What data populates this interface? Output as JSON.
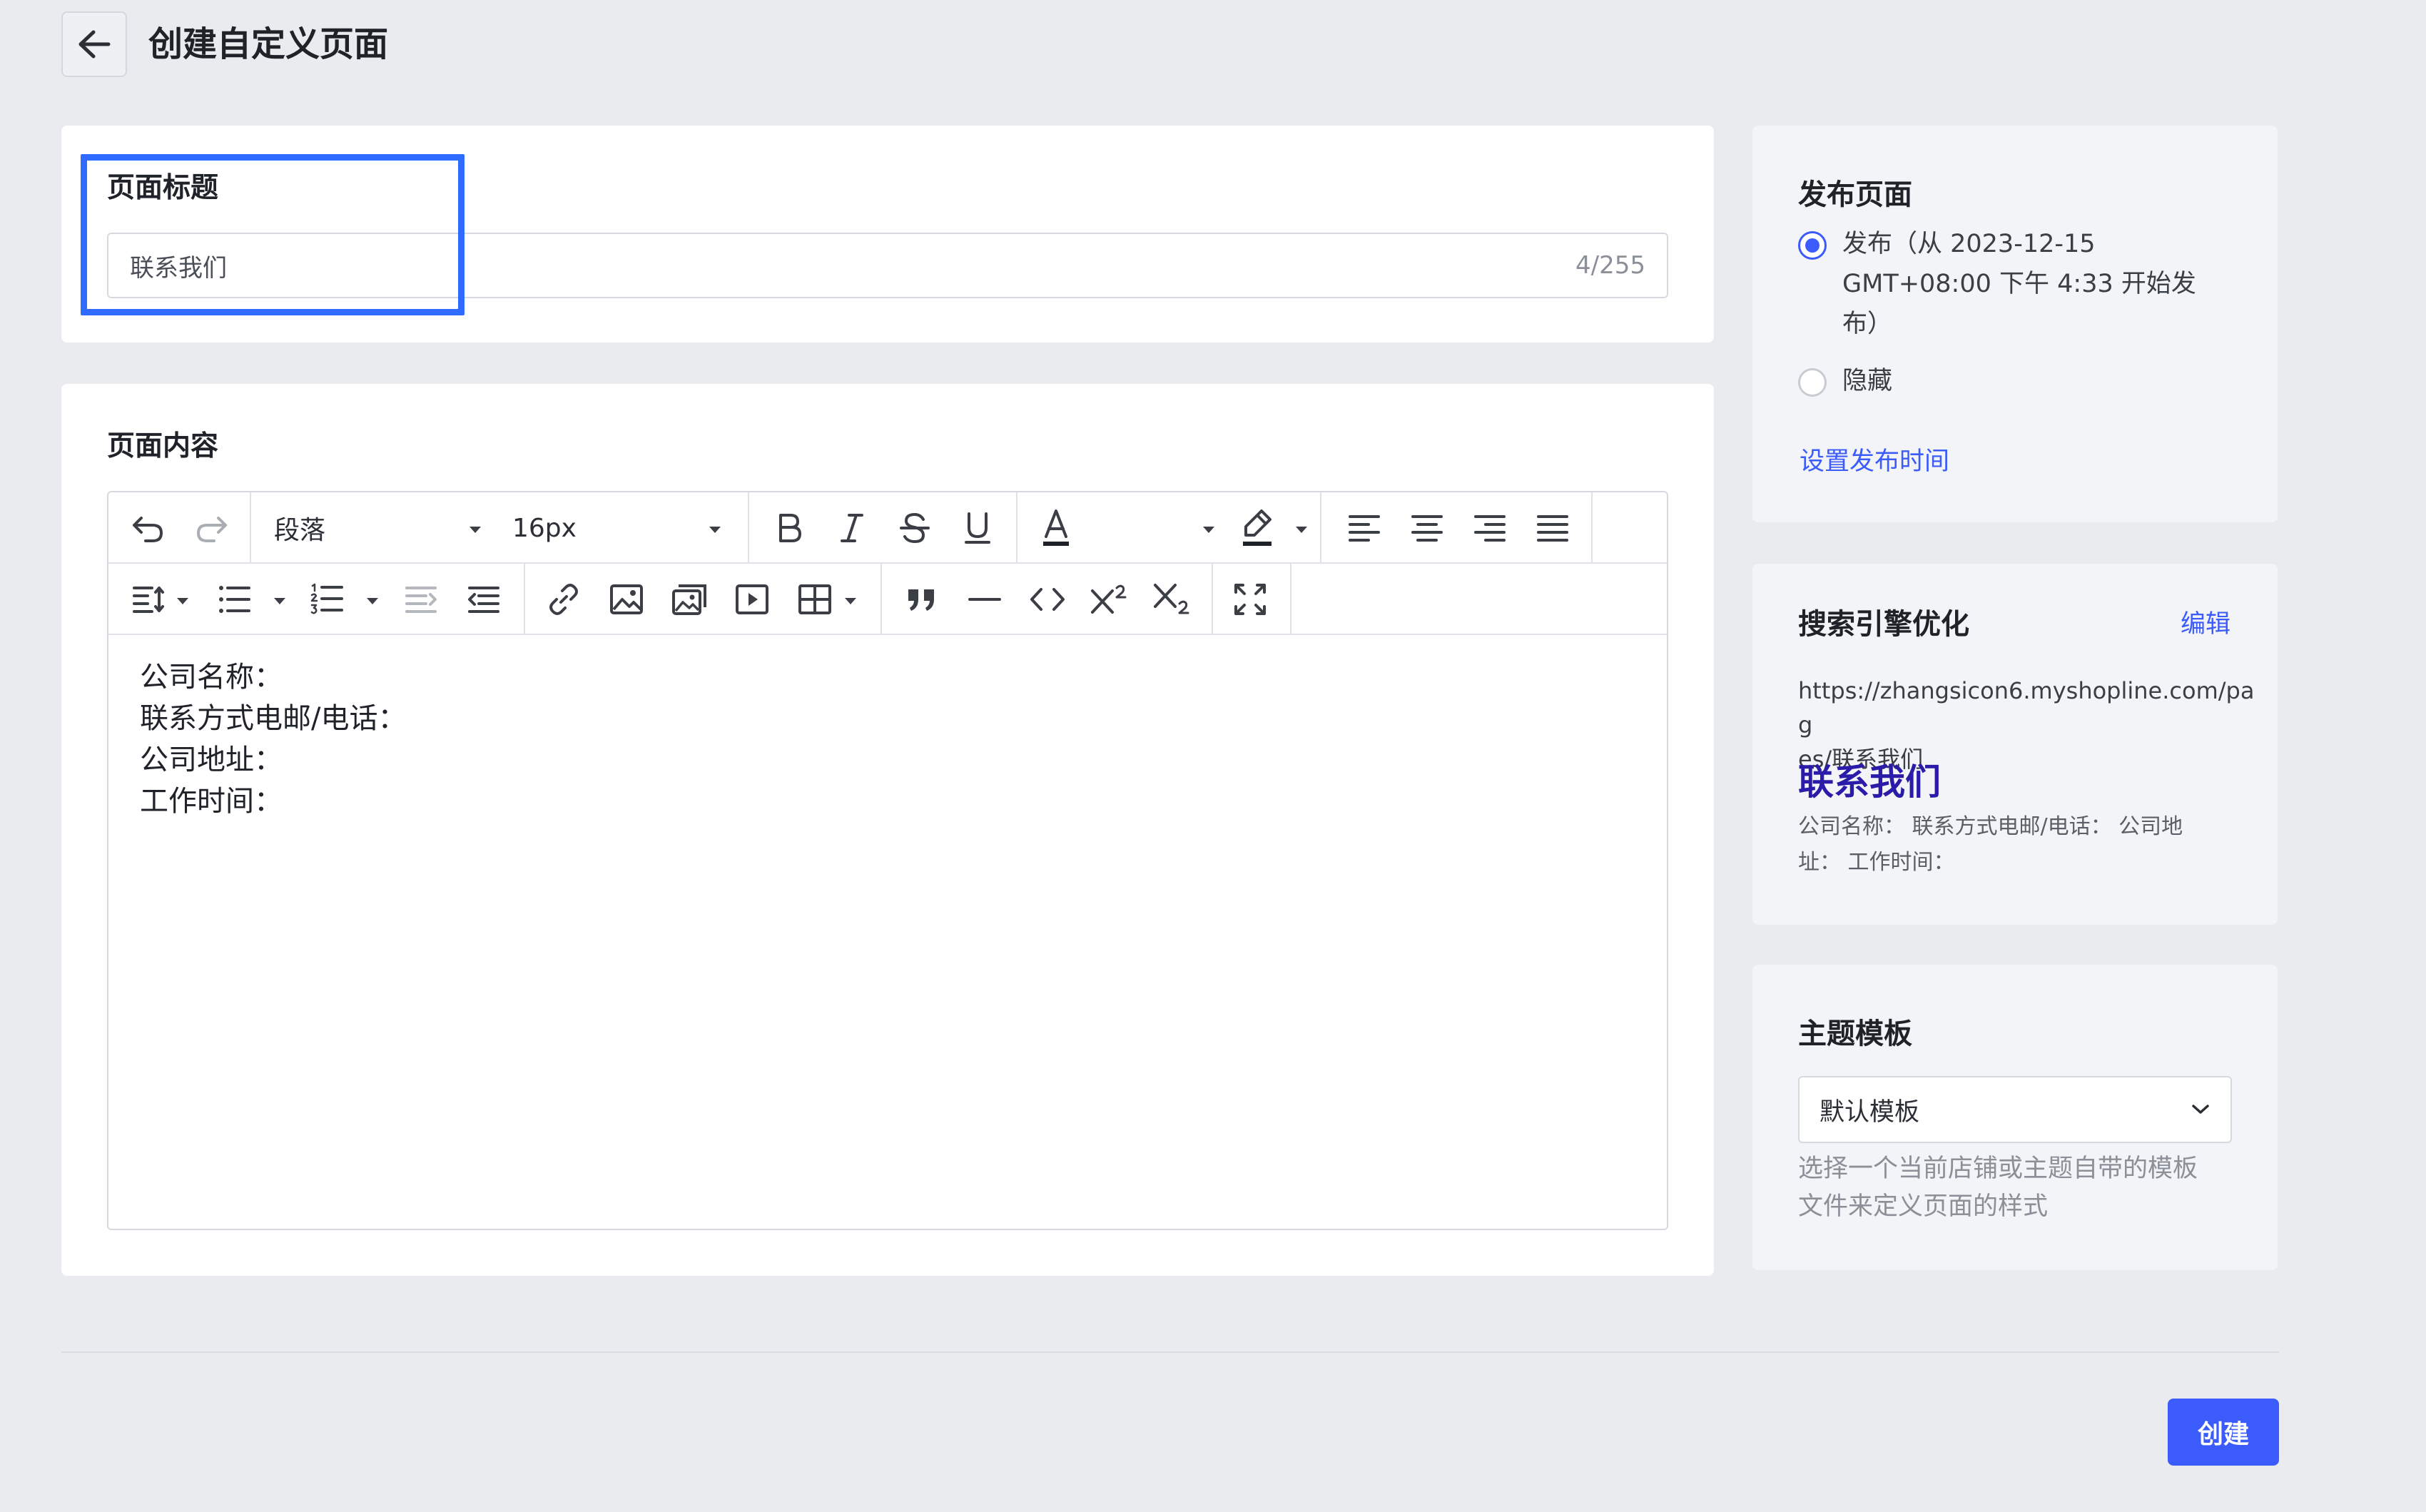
{
  "header": {
    "title": "创建自定义页面"
  },
  "title_card": {
    "label": "页面标题",
    "input_value": "联系我们",
    "char_count": "4/255"
  },
  "content_card": {
    "label": "页面内容",
    "toolbar": {
      "block_format": "段落",
      "font_size": "16px"
    },
    "body_lines": [
      "公司名称：",
      "联系方式电邮/电话：",
      "公司地址：",
      "工作时间："
    ]
  },
  "publish": {
    "title": "发布页面",
    "options": [
      {
        "lines": [
          "发布（从 2023-12-15",
          "GMT+08:00 下午 4:33 开始发",
          "布）"
        ],
        "selected": true
      },
      {
        "lines": [
          "隐藏"
        ],
        "selected": false
      }
    ],
    "set_time_link": "设置发布时间"
  },
  "seo": {
    "title": "搜索引擎优化",
    "edit_link": "编辑",
    "url_lines": [
      "https://zhangsicon6.myshopline.com/pag",
      "es/联系我们"
    ],
    "preview_title": "联系我们",
    "desc_lines": [
      "公司名称： 联系方式电邮/电话： 公司地",
      "址： 工作时间："
    ]
  },
  "theme": {
    "title": "主题模板",
    "selected": "默认模板",
    "hint_lines": [
      "选择一个当前店铺或主题自带的模板",
      "文件来定义页面的样式"
    ]
  },
  "footer": {
    "create_label": "创建"
  },
  "colors": {
    "accent": "#3b5bfa",
    "highlight": "#2f6bff",
    "background": "#e9ebef"
  }
}
